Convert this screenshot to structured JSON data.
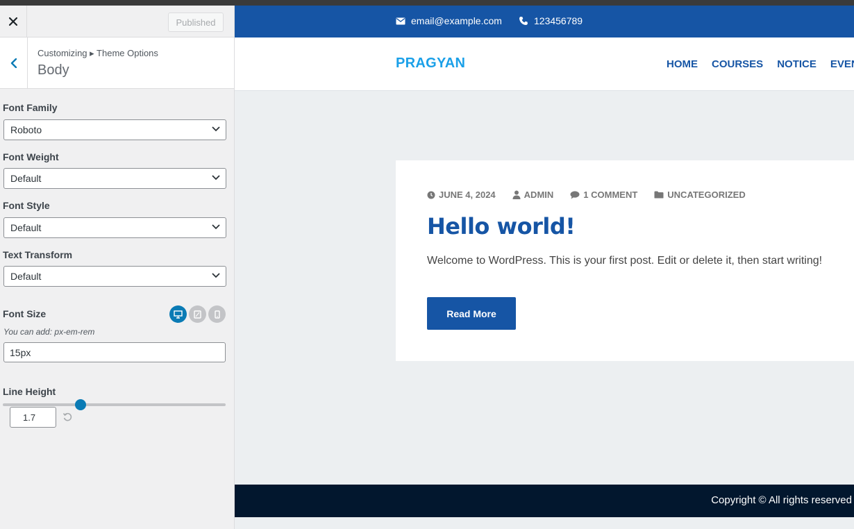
{
  "customizer": {
    "published_label": "Published",
    "breadcrumb": "Customizing ▸ Theme Options",
    "section_title": "Body",
    "controls": {
      "font_family": {
        "label": "Font Family",
        "value": "Roboto"
      },
      "font_weight": {
        "label": "Font Weight",
        "value": "Default"
      },
      "font_style": {
        "label": "Font Style",
        "value": "Default"
      },
      "text_transform": {
        "label": "Text Transform",
        "value": "Default"
      },
      "font_size": {
        "label": "Font Size",
        "hint": "You can add: px-em-rem",
        "value": "15px",
        "active_device": "desktop"
      },
      "line_height": {
        "label": "Line Height",
        "value": "1.7"
      }
    },
    "colors": {
      "accent": "#0a7bb5",
      "border": "#dcdcde"
    }
  },
  "preview": {
    "topbar": {
      "email": "email@example.com",
      "phone": "123456789",
      "background": "#1655a5"
    },
    "site_title": "PRAGYAN",
    "nav": [
      "HOME",
      "COURSES",
      "NOTICE",
      "EVENTS"
    ],
    "post": {
      "date": "JUNE 4, 2024",
      "author": "ADMIN",
      "comments": "1 COMMENT",
      "category": "UNCATEGORIZED",
      "title": "Hello world!",
      "excerpt": "Welcome to WordPress. This is your first post. Edit or delete it, then start writing!",
      "read_more": "Read More"
    },
    "footer": {
      "copyright": "Copyright © All rights reserved"
    }
  }
}
